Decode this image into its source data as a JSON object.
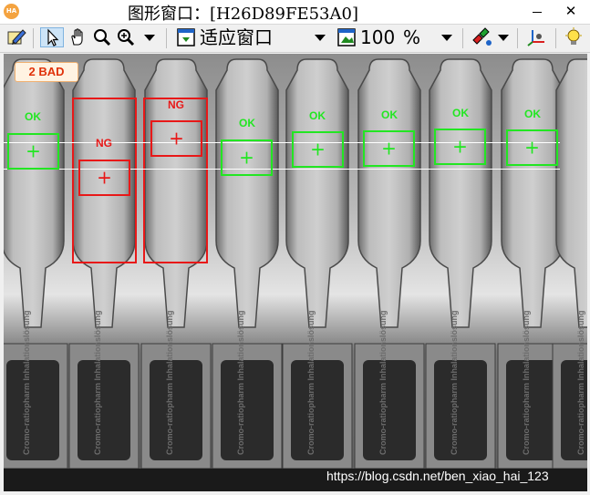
{
  "window": {
    "title": "图形窗口：[H26D89FE53A0]",
    "logo_text": "HA",
    "minimize_icon": "minimize-icon",
    "close_label": "✕"
  },
  "toolbar": {
    "icons": [
      "edit-pencil-icon",
      "pointer-icon",
      "pan-hand-icon",
      "magnifier-icon",
      "zoom-in-icon",
      "fit-window-icon",
      "zoom-percent-icon",
      "color-pick-icon",
      "axes-icon",
      "lightbulb-icon"
    ],
    "fit_label": "适应窗口",
    "zoom_value": "100",
    "zoom_unit": "%"
  },
  "inspection": {
    "summary": "2  BAD",
    "results": [
      {
        "id": 1,
        "status": "OK"
      },
      {
        "id": 2,
        "status": "NG"
      },
      {
        "id": 3,
        "status": "NG"
      },
      {
        "id": 4,
        "status": "OK"
      },
      {
        "id": 5,
        "status": "OK"
      },
      {
        "id": 6,
        "status": "OK"
      },
      {
        "id": 7,
        "status": "OK"
      },
      {
        "id": 8,
        "status": "OK"
      }
    ],
    "plus_glyph": "+",
    "box_colors": {
      "ok": "#22e622",
      "ng": "#e81818"
    },
    "vial_text": "Cromo-ratiopharm Inhalationslösung"
  },
  "watermark": "https://blog.csdn.net/ben_xiao_hai_123"
}
